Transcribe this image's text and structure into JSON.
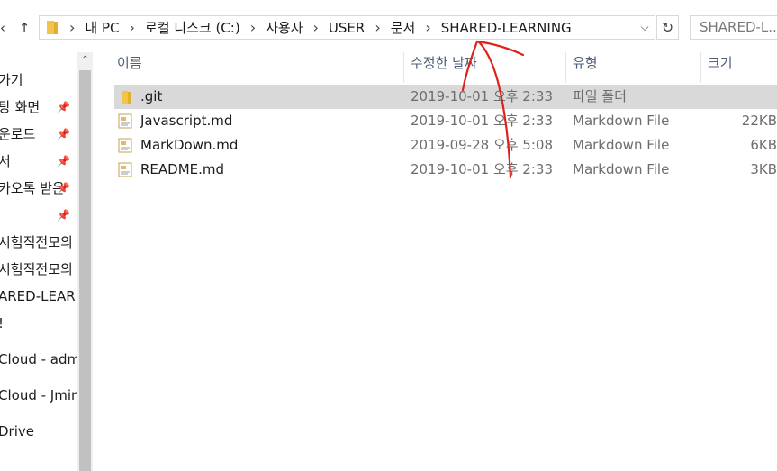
{
  "toolbar": {
    "back_glyph": "‹",
    "up_glyph": "↑",
    "address": {
      "crumbs": [
        "내 PC",
        "로컬 디스크 (C:)",
        "사용자",
        "USER",
        "문서",
        "SHARED-LEARNING"
      ],
      "separator": "›",
      "dropdown_glyph": "⌵",
      "refresh_glyph": "↻"
    },
    "search_placeholder": "SHARED-L..."
  },
  "sidebar": {
    "scroll_up_glyph": "⌃",
    "pin_glyph": "📌",
    "items": [
      {
        "label": "가기"
      },
      {
        "label": "탕 화면",
        "pinned": true
      },
      {
        "label": "운로드",
        "pinned": true
      },
      {
        "label": "서",
        "pinned": true
      },
      {
        "label": "카오톡 받은",
        "pinned": true
      },
      {
        "label": "",
        "pinned": true
      },
      {
        "label": "시험직전모의"
      },
      {
        "label": "시험직전모의"
      },
      {
        "label": "ARED-LEARN"
      },
      {
        "label": "!"
      },
      {
        "label": "Cloud - admi"
      },
      {
        "label": "Cloud - Jmin"
      },
      {
        "label": "Drive"
      }
    ]
  },
  "file_list": {
    "sort_glyph": "^",
    "columns": [
      "이름",
      "수정한 날짜",
      "유형",
      "크기"
    ],
    "rows": [
      {
        "name": ".git",
        "date": "2019-10-01 오후 2:33",
        "type": "파일 폴더",
        "size": "",
        "kind": "folder",
        "selected": true
      },
      {
        "name": "Javascript.md",
        "date": "2019-10-01 오후 2:33",
        "type": "Markdown File",
        "size": "22KB",
        "kind": "md"
      },
      {
        "name": "MarkDown.md",
        "date": "2019-09-28 오후 5:08",
        "type": "Markdown File",
        "size": "6KB",
        "kind": "md"
      },
      {
        "name": "README.md",
        "date": "2019-10-01 오후 2:33",
        "type": "Markdown File",
        "size": "3KB",
        "kind": "md"
      }
    ]
  },
  "colors": {
    "folder": "#f3c44a",
    "selection": "#d9d9d9",
    "header_text": "#4c607a",
    "annotation": "#e0201a"
  }
}
